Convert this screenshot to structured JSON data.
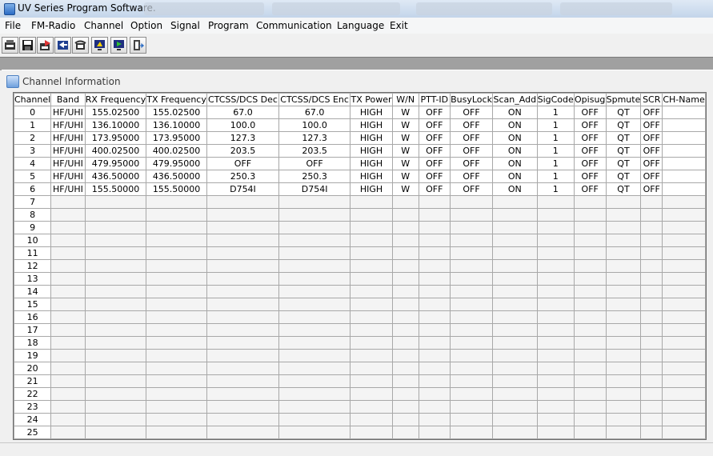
{
  "window": {
    "title": "UV Series Program Software."
  },
  "menu": [
    "File",
    "FM-Radio",
    "Channel",
    "Option",
    "Signal",
    "Program",
    "Communication",
    "Language",
    "Exit"
  ],
  "toolbar": {
    "buttons": [
      {
        "icon": "read-radio-icon"
      },
      {
        "icon": "save-icon"
      },
      {
        "icon": "write-radio-icon"
      },
      {
        "icon": "import-icon"
      },
      {
        "icon": "phone-icon"
      },
      {
        "icon": "monitor-icon"
      },
      {
        "icon": "monitor-run-icon"
      },
      {
        "icon": "exit-door-icon"
      }
    ]
  },
  "panel": {
    "title": "Channel Information"
  },
  "table": {
    "columns": [
      "Channel",
      "Band",
      "RX Frequency",
      "TX Frequency",
      "CTCSS/DCS Dec",
      "CTCSS/DCS Enc",
      "TX Power",
      "W/N",
      "PTT-ID",
      "BusyLock",
      "Scan_Add",
      "SigCode",
      "Opisug",
      "Spmute",
      "SCR",
      "CH-Name"
    ],
    "rows": [
      [
        "0",
        "HF/UHI",
        "155.02500",
        "155.02500",
        "67.0",
        "67.0",
        "HIGH",
        "W",
        "OFF",
        "OFF",
        "ON",
        "1",
        "OFF",
        "QT",
        "OFF",
        ""
      ],
      [
        "1",
        "HF/UHI",
        "136.10000",
        "136.10000",
        "100.0",
        "100.0",
        "HIGH",
        "W",
        "OFF",
        "OFF",
        "ON",
        "1",
        "OFF",
        "QT",
        "OFF",
        ""
      ],
      [
        "2",
        "HF/UHI",
        "173.95000",
        "173.95000",
        "127.3",
        "127.3",
        "HIGH",
        "W",
        "OFF",
        "OFF",
        "ON",
        "1",
        "OFF",
        "QT",
        "OFF",
        ""
      ],
      [
        "3",
        "HF/UHI",
        "400.02500",
        "400.02500",
        "203.5",
        "203.5",
        "HIGH",
        "W",
        "OFF",
        "OFF",
        "ON",
        "1",
        "OFF",
        "QT",
        "OFF",
        ""
      ],
      [
        "4",
        "HF/UHI",
        "479.95000",
        "479.95000",
        "OFF",
        "OFF",
        "HIGH",
        "W",
        "OFF",
        "OFF",
        "ON",
        "1",
        "OFF",
        "QT",
        "OFF",
        ""
      ],
      [
        "5",
        "HF/UHI",
        "436.50000",
        "436.50000",
        "250.3",
        "250.3",
        "HIGH",
        "W",
        "OFF",
        "OFF",
        "ON",
        "1",
        "OFF",
        "QT",
        "OFF",
        ""
      ],
      [
        "6",
        "HF/UHI",
        "155.50000",
        "155.50000",
        "D754I",
        "D754I",
        "HIGH",
        "W",
        "OFF",
        "OFF",
        "ON",
        "1",
        "OFF",
        "QT",
        "OFF",
        ""
      ]
    ],
    "empty_channels": [
      "7",
      "8",
      "9",
      "10",
      "11",
      "12",
      "13",
      "14",
      "15",
      "16",
      "17",
      "18",
      "19",
      "20",
      "21",
      "22",
      "23",
      "24",
      "25"
    ]
  }
}
